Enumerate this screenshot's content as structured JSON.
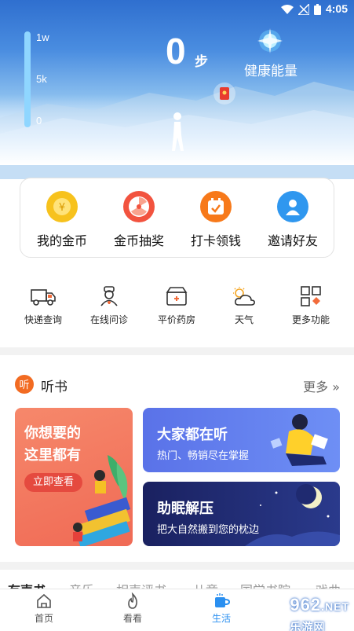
{
  "status": {
    "time": "4:05"
  },
  "gauge": {
    "labels": [
      "1w",
      "5k",
      "0"
    ],
    "level": 0
  },
  "steps": {
    "value": "0",
    "unit": "步"
  },
  "energy": {
    "label": "健康能量"
  },
  "actions": [
    {
      "label": "我的金币",
      "icon": "coin-icon",
      "color": "#f7c21d"
    },
    {
      "label": "金币抽奖",
      "icon": "lottery-wheel-icon",
      "color": "#f2533f"
    },
    {
      "label": "打卡领钱",
      "icon": "check-in-calendar-icon",
      "color": "#f7791a"
    },
    {
      "label": "邀请好友",
      "icon": "invite-friend-icon",
      "color": "#2f97ef"
    }
  ],
  "quick": [
    {
      "label": "快递查询",
      "icon": "delivery-truck-icon"
    },
    {
      "label": "在线问诊",
      "icon": "doctor-icon"
    },
    {
      "label": "平价药房",
      "icon": "medicine-box-icon"
    },
    {
      "label": "天气",
      "icon": "weather-icon"
    },
    {
      "label": "更多功能",
      "icon": "more-grid-icon"
    }
  ],
  "audiobook": {
    "icon_text": "听",
    "title": "听书",
    "more": "更多",
    "tile1": {
      "title_line1": "你想要的",
      "title_line2": "这里都有",
      "button": "立即查看"
    },
    "tile2": {
      "title": "大家都在听",
      "subtitle": "热门、畅销尽在掌握"
    },
    "tile3": {
      "title": "助眠解压",
      "subtitle": "把大自然搬到您的枕边"
    }
  },
  "categories": [
    "有声书",
    "音乐",
    "相声评书",
    "儿童",
    "国学书院",
    "戏曲"
  ],
  "tabs": [
    {
      "label": "首页",
      "icon": "home-icon"
    },
    {
      "label": "看看",
      "icon": "flame-icon"
    },
    {
      "label": "生活",
      "icon": "mug-icon",
      "active": true
    }
  ],
  "watermark": {
    "main": "962",
    "sub": ".NET",
    "cn": "乐游网"
  }
}
